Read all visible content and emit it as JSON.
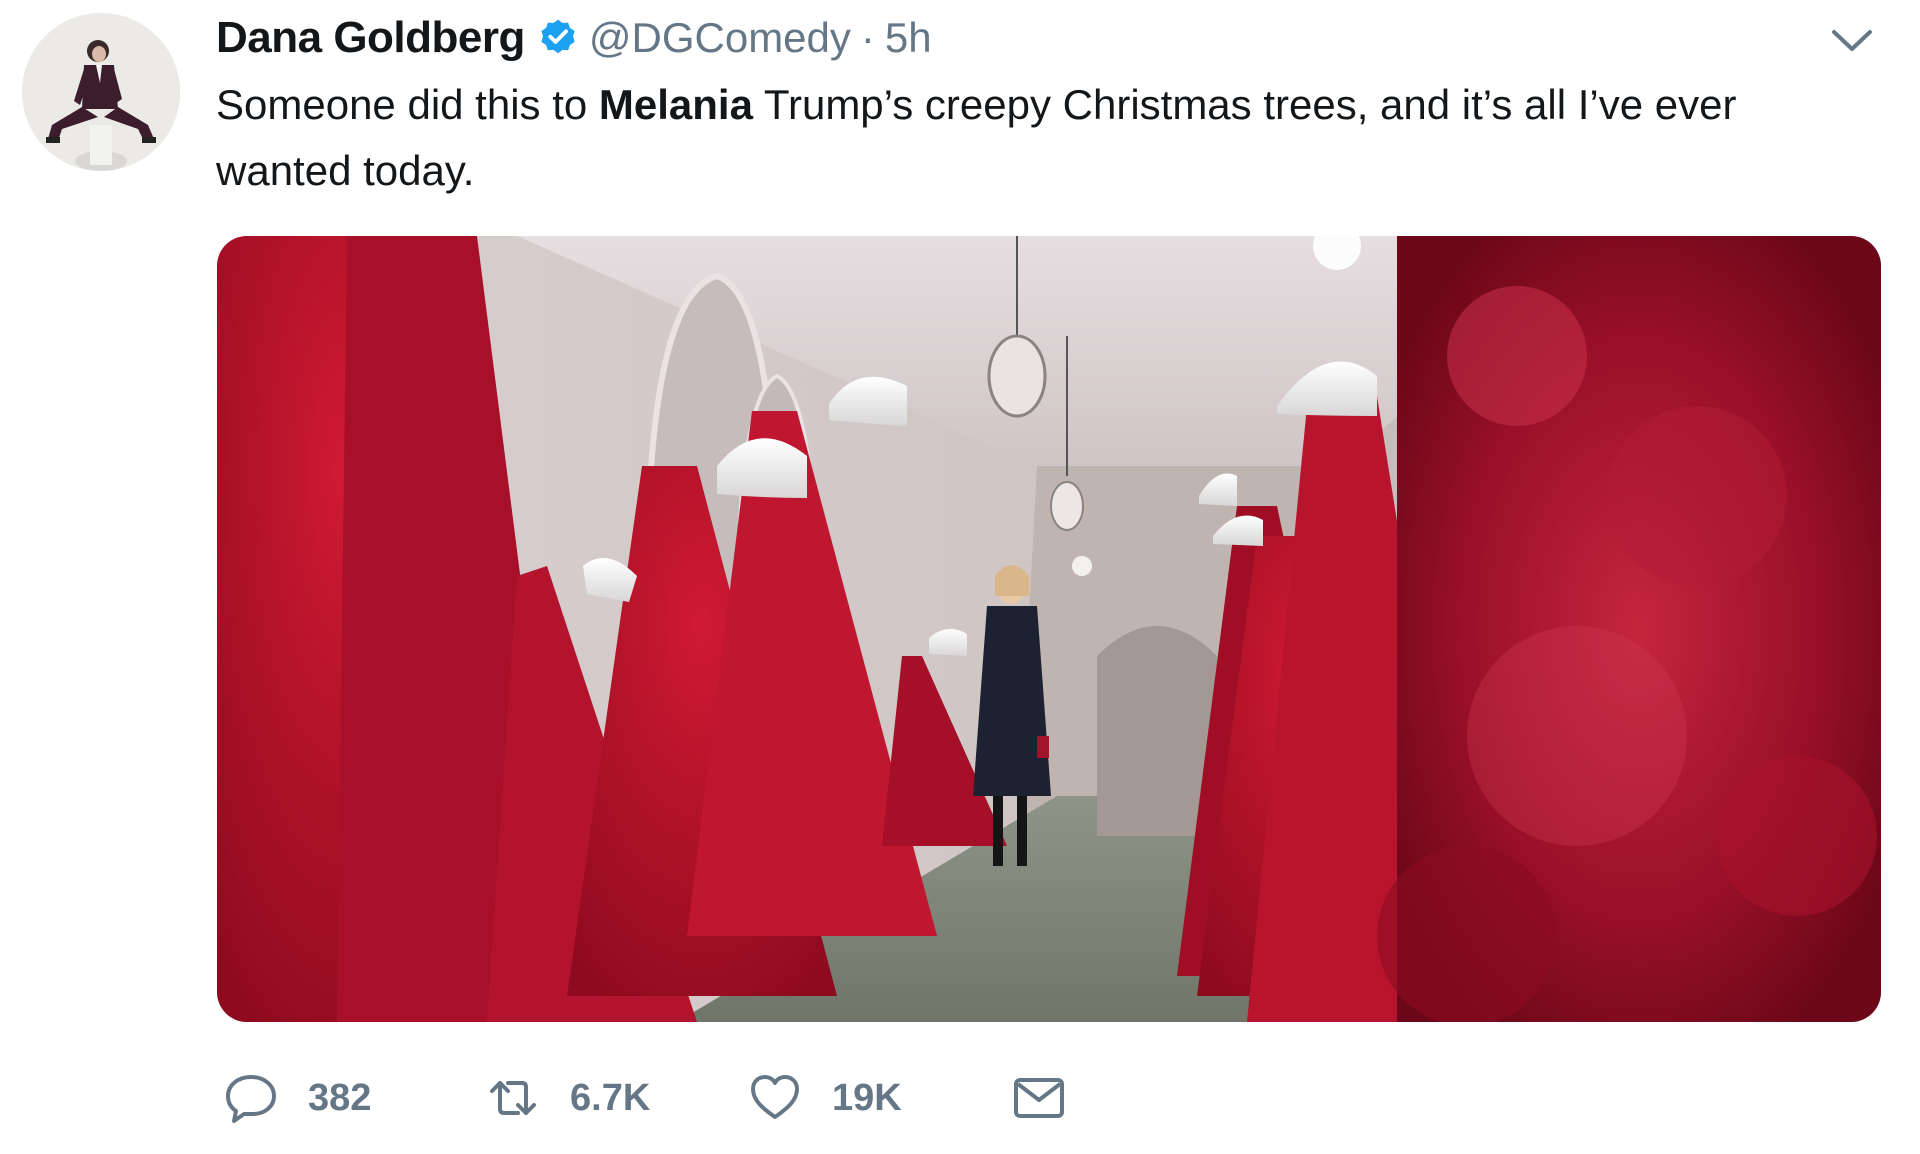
{
  "author": {
    "display_name": "Dana Goldberg",
    "handle": "@DGComedy",
    "separator": "·",
    "time": "5h",
    "verified": true
  },
  "tweet": {
    "text_before": "Someone did this to ",
    "text_bold": "Melania",
    "text_after": " Trump’s creepy Christmas trees, and it’s all I’ve ever wanted today."
  },
  "actions": {
    "reply_count": "382",
    "retweet_count": "6.7K",
    "like_count": "19K"
  },
  "icons": {
    "reply": "reply-icon",
    "retweet": "retweet-icon",
    "like": "heart-icon",
    "dm": "envelope-icon",
    "verified": "verified-badge-icon",
    "menu": "chevron-down-icon"
  },
  "colors": {
    "text": "#14171a",
    "secondary": "#657786",
    "verified": "#1da1f2",
    "tree_red": "#b0112a"
  }
}
